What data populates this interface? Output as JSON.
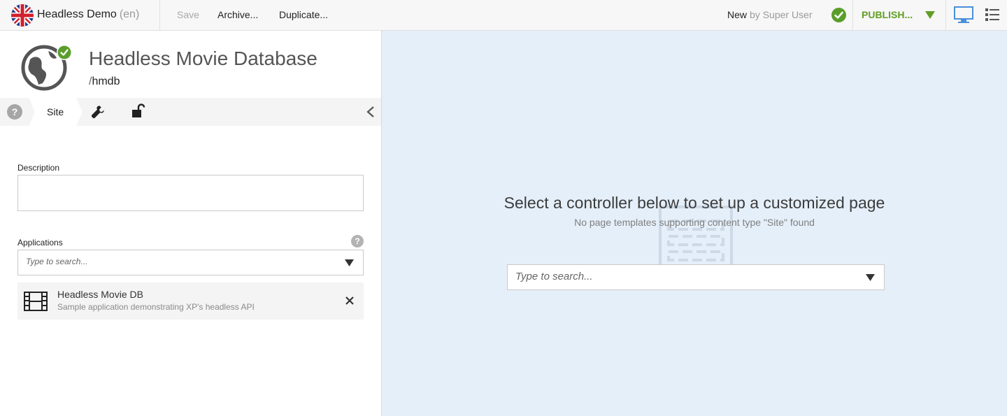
{
  "toolbar": {
    "project_name": "Headless Demo",
    "language": "(en)",
    "save_label": "Save",
    "archive_label": "Archive...",
    "duplicate_label": "Duplicate...",
    "status_label": "New",
    "status_by": "by Super User",
    "publish_label": "PUBLISH...",
    "colors": {
      "publish": "#609e24",
      "ok": "#5a9e2a",
      "monitor": "#4a90d9"
    }
  },
  "site": {
    "title": "Headless Movie Database",
    "path_prefix": "/",
    "path": "hmdb",
    "icon": "globe-icon"
  },
  "tabs": {
    "help_label": "?",
    "site_label": "Site"
  },
  "form": {
    "description_label": "Description",
    "description_value": "",
    "applications_label": "Applications",
    "applications_help": "?",
    "applications_placeholder": "Type to search...",
    "applications": [
      {
        "name": "Headless Movie DB",
        "description": "Sample application demonstrating XP's headless API",
        "icon": "film-icon"
      }
    ]
  },
  "page_editor": {
    "title": "Select a controller below to set up a customized page",
    "subtitle": "No page templates supporting content type \"Site\" found",
    "controller_placeholder": "Type to search...",
    "background": "#e5eff9"
  }
}
